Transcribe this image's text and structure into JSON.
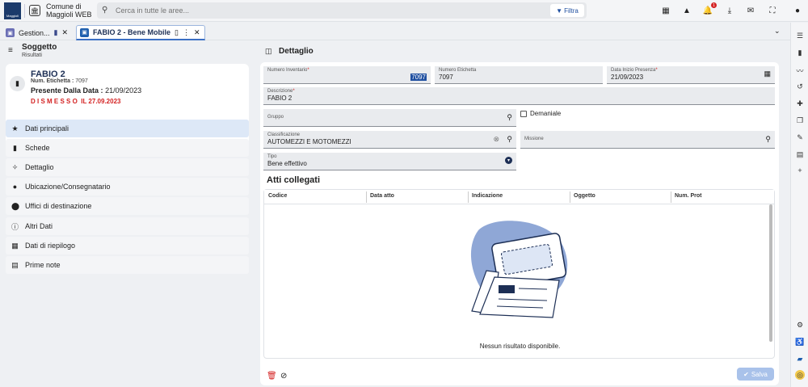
{
  "topbar": {
    "logo_text": "Maggioli",
    "org_line1": "Comune di",
    "org_line2": "Maggioli WEB",
    "search_placeholder": "Cerca in tutte le aree...",
    "filter_label": "Filtra",
    "notification_count": "1"
  },
  "tabs": [
    {
      "label": "Gestion..."
    },
    {
      "label": "FABIO 2 - Bene Mobile"
    }
  ],
  "left": {
    "title": "Soggetto",
    "subtitle": "Risultati",
    "card": {
      "name": "FABIO 2",
      "etichetta_label": "Num. Etichetta :",
      "etichetta_value": "7097",
      "presente_label": "Presente Dalla Data :",
      "presente_value": "21/09/2023",
      "status": "D I S M E S S O  IL 27.09.2023"
    },
    "menu": [
      {
        "label": "Dati principali",
        "icon": "star-icon"
      },
      {
        "label": "Schede",
        "icon": "document-icon"
      },
      {
        "label": "Dettaglio",
        "icon": "magic-wand-icon"
      },
      {
        "label": "Ubicazione/Consegnatario",
        "icon": "person-icon"
      },
      {
        "label": "Uffici di destinazione",
        "icon": "location-pin-icon"
      },
      {
        "label": "Altri Dati",
        "icon": "info-icon"
      },
      {
        "label": "Dati di riepilogo",
        "icon": "calculator-icon"
      },
      {
        "label": "Prime note",
        "icon": "table-icon"
      }
    ]
  },
  "main": {
    "title": "Dettaglio",
    "fields": {
      "num_inventario": {
        "label": "Numero Inventario",
        "value": "7097"
      },
      "num_etichetta": {
        "label": "Numero Etichetta",
        "value": "7097"
      },
      "data_inizio": {
        "label": "Data Inizio Presenza",
        "value": "21/09/2023"
      },
      "descrizione": {
        "label": "Descrizione",
        "value": "FABIO 2"
      },
      "gruppo": {
        "label": "Gruppo",
        "value": ""
      },
      "demaniale": {
        "label": "Demaniale"
      },
      "classificazione": {
        "label": "Classificazione",
        "value": "AUTOMEZZI E MOTOMEZZI"
      },
      "missione": {
        "label": "Missione",
        "value": ""
      },
      "tipo": {
        "label": "Tipo",
        "value": "Bene effettivo"
      }
    },
    "atti": {
      "title": "Atti collegati",
      "columns": [
        "Codice",
        "Data atto",
        "Indicazione",
        "Oggetto",
        "Num. Prot"
      ],
      "empty_text": "Nessun risultato disponibile."
    },
    "save_label": "Salva"
  }
}
